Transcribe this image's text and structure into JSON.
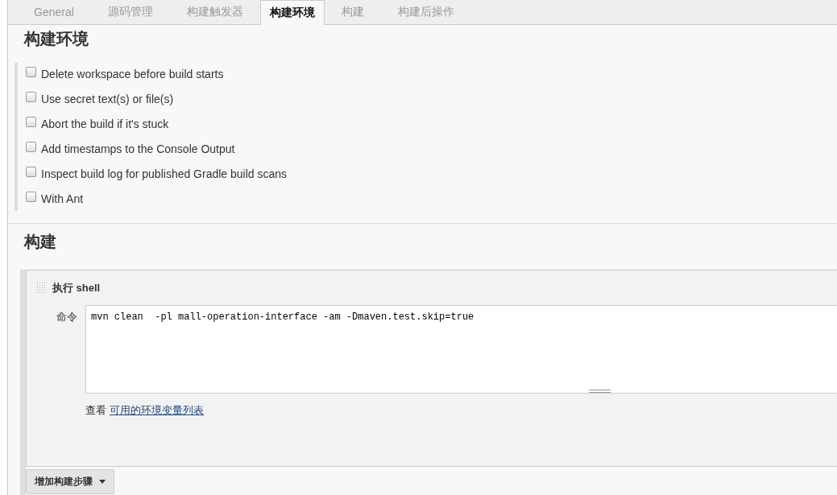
{
  "tabs": [
    {
      "label": "General",
      "selected": false
    },
    {
      "label": "源码管理",
      "selected": false
    },
    {
      "label": "构建触发器",
      "selected": false
    },
    {
      "label": "构建环境",
      "selected": true
    },
    {
      "label": "构建",
      "selected": false
    },
    {
      "label": "构建后操作",
      "selected": false
    }
  ],
  "build_environment": {
    "title": "构建环境",
    "options": [
      {
        "label": "Delete workspace before build starts",
        "checked": false
      },
      {
        "label": "Use secret text(s) or file(s)",
        "checked": false
      },
      {
        "label": "Abort the build if it's stuck",
        "checked": false
      },
      {
        "label": "Add timestamps to the Console Output",
        "checked": false
      },
      {
        "label": "Inspect build log for published Gradle build scans",
        "checked": false
      },
      {
        "label": "With Ant",
        "checked": false
      }
    ]
  },
  "build": {
    "title": "构建",
    "step": {
      "title": "执行 shell",
      "command_label": "命令",
      "command": "mvn clean  -pl mall-operation-interface -am -Dmaven.test.skip=true",
      "help_prefix": "查看",
      "help_link": "可用的环境变量列表"
    },
    "add_button": "增加构建步骤"
  }
}
